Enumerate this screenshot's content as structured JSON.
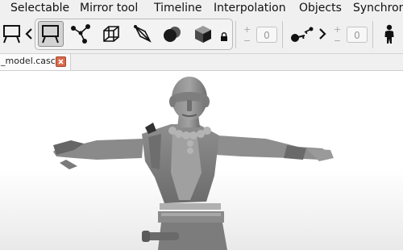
{
  "menubar": {
    "items": [
      "Selectable",
      "Mirror tool",
      "Timeline",
      "Interpolation",
      "Objects",
      "Synchron"
    ]
  },
  "toolbar": {
    "mode_group": [
      "select-frame-icon",
      "vertex-graph-icon",
      "wireframe-cube-icon",
      "bone-icon",
      "shaded-spheres-icon",
      "solid-cube-icon",
      "lock-icon"
    ],
    "counter_left": "0",
    "counter_right": "0",
    "plus": "+",
    "minus": "−"
  },
  "tabs": [
    {
      "label": "_model.casc"
    }
  ],
  "viewport": {
    "content": "3d-character-model"
  }
}
